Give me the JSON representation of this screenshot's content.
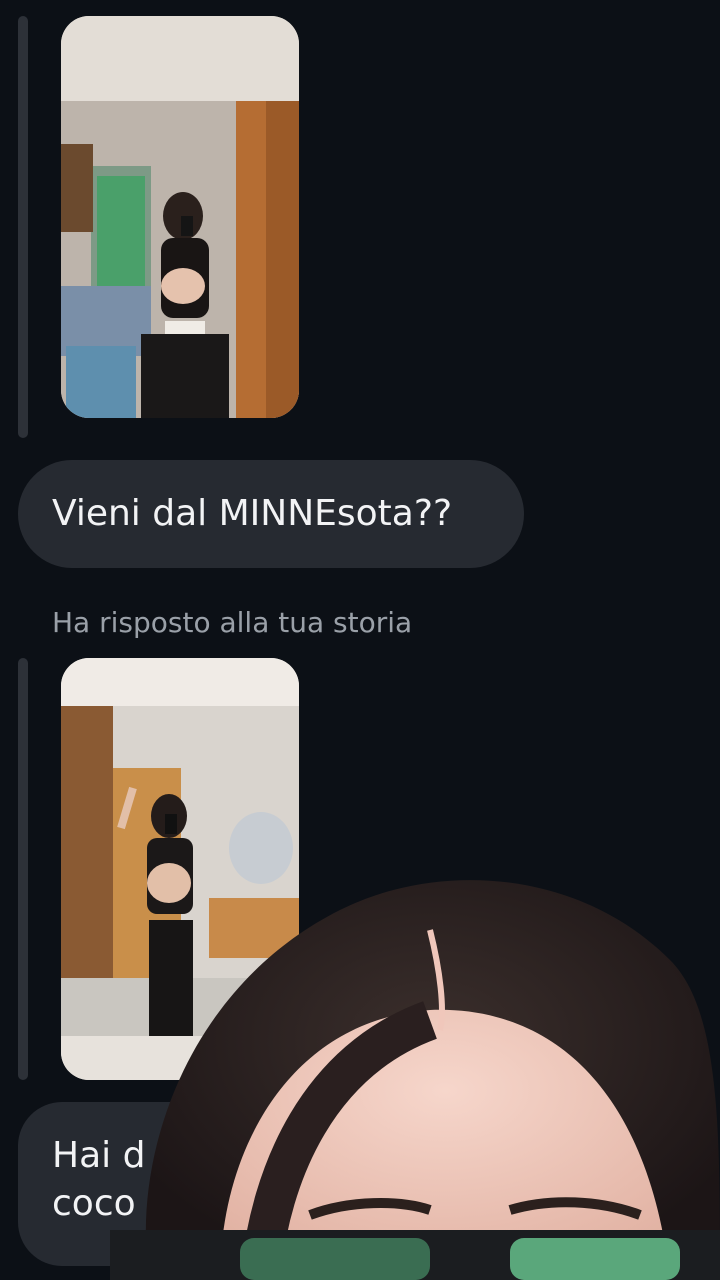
{
  "messages": [
    {
      "type": "story_reply_media",
      "content": "mirror selfie photo"
    },
    {
      "type": "text",
      "text": "Vieni dal MINNEsota??"
    },
    {
      "type": "caption",
      "text": "Ha risposto alla tua storia"
    },
    {
      "type": "story_reply_media",
      "content": "mirror selfie photo"
    },
    {
      "type": "text_partial",
      "line1": "Hai d",
      "line2": "coco"
    }
  ],
  "colors": {
    "background": "#0c1016",
    "bubble": "#262a31",
    "bubble_text": "#f2f3f5",
    "caption_text": "#9aa0a8",
    "reply_bar": "#2d3138"
  },
  "overlay": {
    "description_icon": "face-camera-overlay"
  }
}
